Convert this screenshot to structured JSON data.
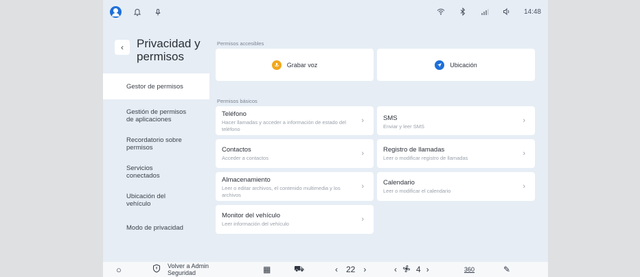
{
  "status_bar": {
    "icons": [
      "avatar-icon",
      "notification-bell-icon",
      "microphone-icon",
      "wifi-icon",
      "bluetooth-icon",
      "cell-signal-icon",
      "volume-icon"
    ],
    "clock": "14:48"
  },
  "header": {
    "back_icon": "‹",
    "title": "Privacidad y permisos"
  },
  "nav": {
    "items": [
      {
        "label": "Gestor de permisos",
        "active": true
      },
      {
        "label": "Gestión de permisos de aplicaciones",
        "active": false
      },
      {
        "label": "Recordatorio sobre permisos",
        "active": false
      },
      {
        "label": "Servicios conectados",
        "active": false
      },
      {
        "label": "Ubicación del vehículo",
        "active": false
      },
      {
        "label": "Modo de privacidad",
        "active": false
      }
    ]
  },
  "main": {
    "quick_label": "Permisos accesibles",
    "quick": [
      {
        "label": "Grabar voz",
        "color": "#f1a81b"
      },
      {
        "label": "Ubicación",
        "color": "#1e6fd9"
      }
    ],
    "basic_label": "Permisos básicos",
    "basic": [
      {
        "title": "Teléfono",
        "desc": "Hacer llamadas y acceder a información de estado del teléfono"
      },
      {
        "title": "SMS",
        "desc": "Enviar y leer SMS"
      },
      {
        "title": "Contactos",
        "desc": "Acceder a contactos"
      },
      {
        "title": "Registro de llamadas",
        "desc": "Leer o modificar registro de llamadas"
      },
      {
        "title": "Almacenamiento",
        "desc": "Leer o editar archivos, el contenido multimedia y los archivos"
      },
      {
        "title": "Calendario",
        "desc": "Leer o modificar el calendario"
      },
      {
        "title": "Monitor del vehículo",
        "desc": "Leer información del vehículo"
      }
    ],
    "chevron": "›"
  },
  "dock": {
    "home_icon": "○",
    "security_line1": "Volver a Admin",
    "security_line2": "Seguridad",
    "apps_icon": "▦",
    "car_icon": "⛟",
    "temp_left_prev": "‹",
    "temp_left": "22",
    "temp_left_next": "›",
    "temp_right_prev": "‹",
    "fan_level": "4",
    "temp_right_next": "›",
    "view_label": "360",
    "pen_icon": "✎"
  }
}
